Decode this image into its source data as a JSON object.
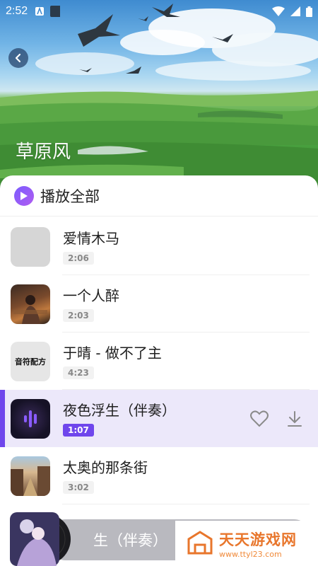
{
  "status_bar": {
    "time": "2:52"
  },
  "album": {
    "title": "草原风"
  },
  "play_all": {
    "label": "播放全部"
  },
  "songs": [
    {
      "title": "爱情木马",
      "duration": "2:06"
    },
    {
      "title": "一个人醉",
      "duration": "2:03"
    },
    {
      "title": "于晴 - 做不了主",
      "duration": "4:23",
      "cover_text": "音符配方"
    },
    {
      "title": "夜色浮生（伴奏）",
      "duration": "1:07",
      "active": true
    },
    {
      "title": "太奥的那条街",
      "duration": "3:02"
    }
  ],
  "mini_player": {
    "title": "生（伴奏）"
  },
  "watermark": {
    "main": "天天游戏网",
    "sub": "www.ttyl23.com"
  },
  "colors": {
    "accent": "#6f46ec",
    "active_row": "#ece8fa"
  },
  "icons": [
    "back-icon",
    "play-icon",
    "heart-icon",
    "download-icon",
    "soundwave-icon"
  ]
}
